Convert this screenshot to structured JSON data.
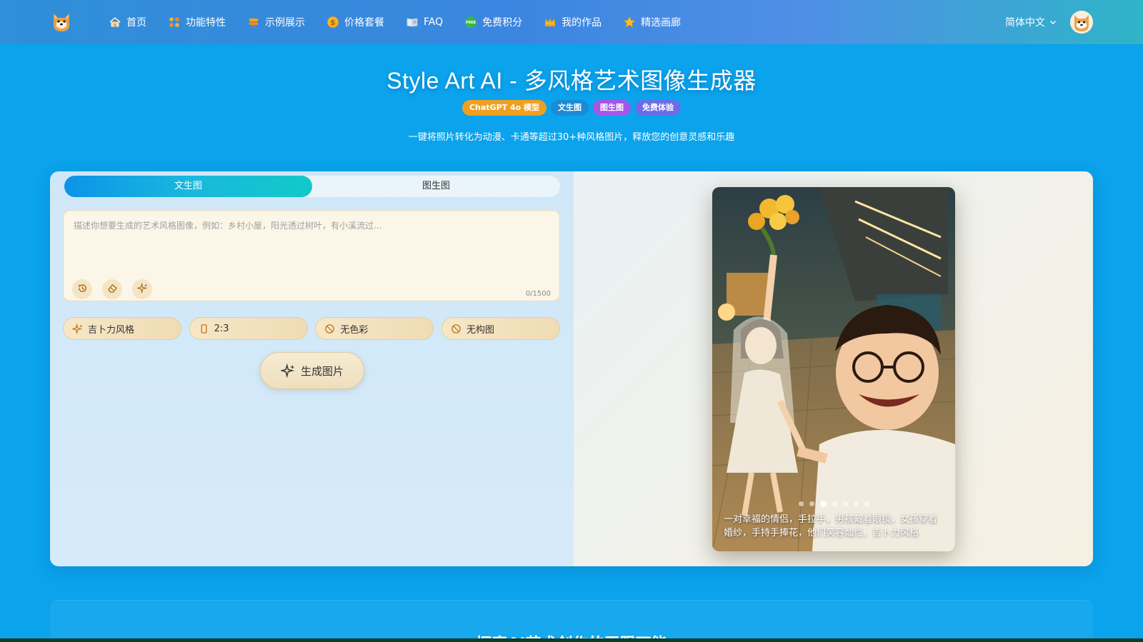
{
  "nav": {
    "logo_icon": "shiba-dog-logo-icon",
    "items": [
      {
        "label": "首页",
        "icon": "home-icon"
      },
      {
        "label": "功能特性",
        "icon": "grid-icon"
      },
      {
        "label": "示例展示",
        "icon": "signpost-icon"
      },
      {
        "label": "价格套餐",
        "icon": "dollar-coin-icon"
      },
      {
        "label": "FAQ",
        "icon": "book-icon"
      },
      {
        "label": "免费积分",
        "icon": "free-badge-icon"
      },
      {
        "label": "我的作品",
        "icon": "crown-icon"
      },
      {
        "label": "精选画廊",
        "icon": "star-icon"
      }
    ],
    "language": "简体中文",
    "avatar_icon": "shiba-avatar-icon"
  },
  "hero": {
    "title": "Style Art AI - 多风格艺术图像生成器",
    "badges": [
      {
        "label": "ChatGPT 4o 模型",
        "color": "#f0a020"
      },
      {
        "label": "文生图",
        "color": "#1c8bd6"
      },
      {
        "label": "图生图",
        "color": "#a456e6"
      },
      {
        "label": "免费体验",
        "color": "#6b6de8"
      }
    ],
    "subtitle": "一键将照片转化为动漫、卡通等超过30+种风格图片，释放您的创意灵感和乐趣"
  },
  "generator": {
    "tabs": [
      {
        "label": "文生图",
        "active": true
      },
      {
        "label": "图生图",
        "active": false
      }
    ],
    "prompt": {
      "value": "",
      "placeholder": "描述你想要生成的艺术风格图像，例如：乡村小屋，阳光透过树叶，有小溪流过...",
      "counter": "0/1500",
      "tools": [
        "history-icon",
        "eraser-icon",
        "sparkle-icon"
      ]
    },
    "options": [
      {
        "label": "吉卜力风格",
        "icon": "sparkle-icon"
      },
      {
        "label": "2:3",
        "icon": "portrait-ratio-icon"
      },
      {
        "label": "无色彩",
        "icon": "ban-icon"
      },
      {
        "label": "无构图",
        "icon": "ban-icon"
      }
    ],
    "generate_label": "生成图片"
  },
  "preview": {
    "caption": "一对幸福的情侣，手拉手，男孩戴着眼镜，女孩穿着婚纱，手持手捧花，他们笑容灿烂，吉卜力风格",
    "dots_total": 7,
    "active_dot": 2
  },
  "bottom": {
    "title": "探索AI艺术创作的无限可能"
  }
}
